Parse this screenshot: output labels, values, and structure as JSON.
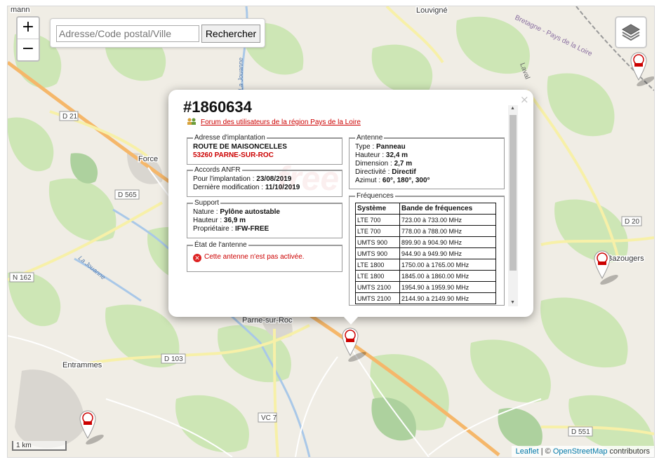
{
  "map": {
    "place_labels": [
      "Force",
      "Parne-sur-Roc",
      "Entrammes",
      "Louvigné",
      "Bazougers",
      "Bretagne - Pays de la Loire",
      "Laval"
    ],
    "partial_labels": [
      "mann"
    ],
    "road_labels": [
      "D 21",
      "D 565",
      "N 162",
      "D 103",
      "VC 7",
      "D 551",
      "D 20"
    ],
    "water_labels": [
      "La Jouanne",
      "La Jouanne"
    ],
    "zoom_in": "+",
    "zoom_out": "−",
    "scale": "1 km",
    "attribution": {
      "leaflet": "Leaflet",
      "separator": " | © ",
      "osm": "OpenStreetMap",
      "suffix": " contributors"
    },
    "marker_icon": "free-4g-antenna-pin-icon"
  },
  "search": {
    "placeholder": "Adresse/Code postal/Ville",
    "button": "Rechercher"
  },
  "popup": {
    "close": "×",
    "title": "#1860634",
    "forum_link": "Forum des utilisateurs de la région Pays de la Loire",
    "address": {
      "legend": "Adresse d'implantation",
      "street": "ROUTE DE MAISONCELLES",
      "city": "53260 PARNE-SUR-ROC"
    },
    "anfr": {
      "legend": "Accords ANFR",
      "implant_label": "Pour l'implantation : ",
      "implant_value": "23/08/2019",
      "modif_label": "Dernière modification : ",
      "modif_value": "11/10/2019"
    },
    "support": {
      "legend": "Support",
      "nature_label": "Nature : ",
      "nature_value": "Pylône autostable",
      "height_label": "Hauteur : ",
      "height_value": "36,9 m",
      "owner_label": "Propriétaire : ",
      "owner_value": "IFW-FREE"
    },
    "state": {
      "legend": "État de l'antenne",
      "text": "Cette antenne n'est pas activée."
    },
    "antenna": {
      "legend": "Antenne",
      "type_label": "Type : ",
      "type_value": "Panneau",
      "height_label": "Hauteur : ",
      "height_value": "32,4 m",
      "dim_label": "Dimension : ",
      "dim_value": "2,7 m",
      "dir_label": "Directivité : ",
      "dir_value": "Directif",
      "az_label": "Azimut : ",
      "az_value": "60°, 180°, 300°"
    },
    "frequencies": {
      "legend": "Fréquences",
      "headers": [
        "Système",
        "Bande de fréquences"
      ],
      "rows": [
        [
          "LTE 700",
          "723.00 à 733.00 MHz"
        ],
        [
          "LTE 700",
          "778.00 à 788.00 MHz"
        ],
        [
          "UMTS 900",
          "899.90 à 904.90 MHz"
        ],
        [
          "UMTS 900",
          "944.90 à 949.90 MHz"
        ],
        [
          "LTE 1800",
          "1750.00 à 1765.00 MHz"
        ],
        [
          "LTE 1800",
          "1845.00 à 1860.00 MHz"
        ],
        [
          "UMTS 2100",
          "1954.90 à 1959.90 MHz"
        ],
        [
          "UMTS 2100",
          "2144.90 à 2149.90 MHz"
        ]
      ]
    }
  }
}
